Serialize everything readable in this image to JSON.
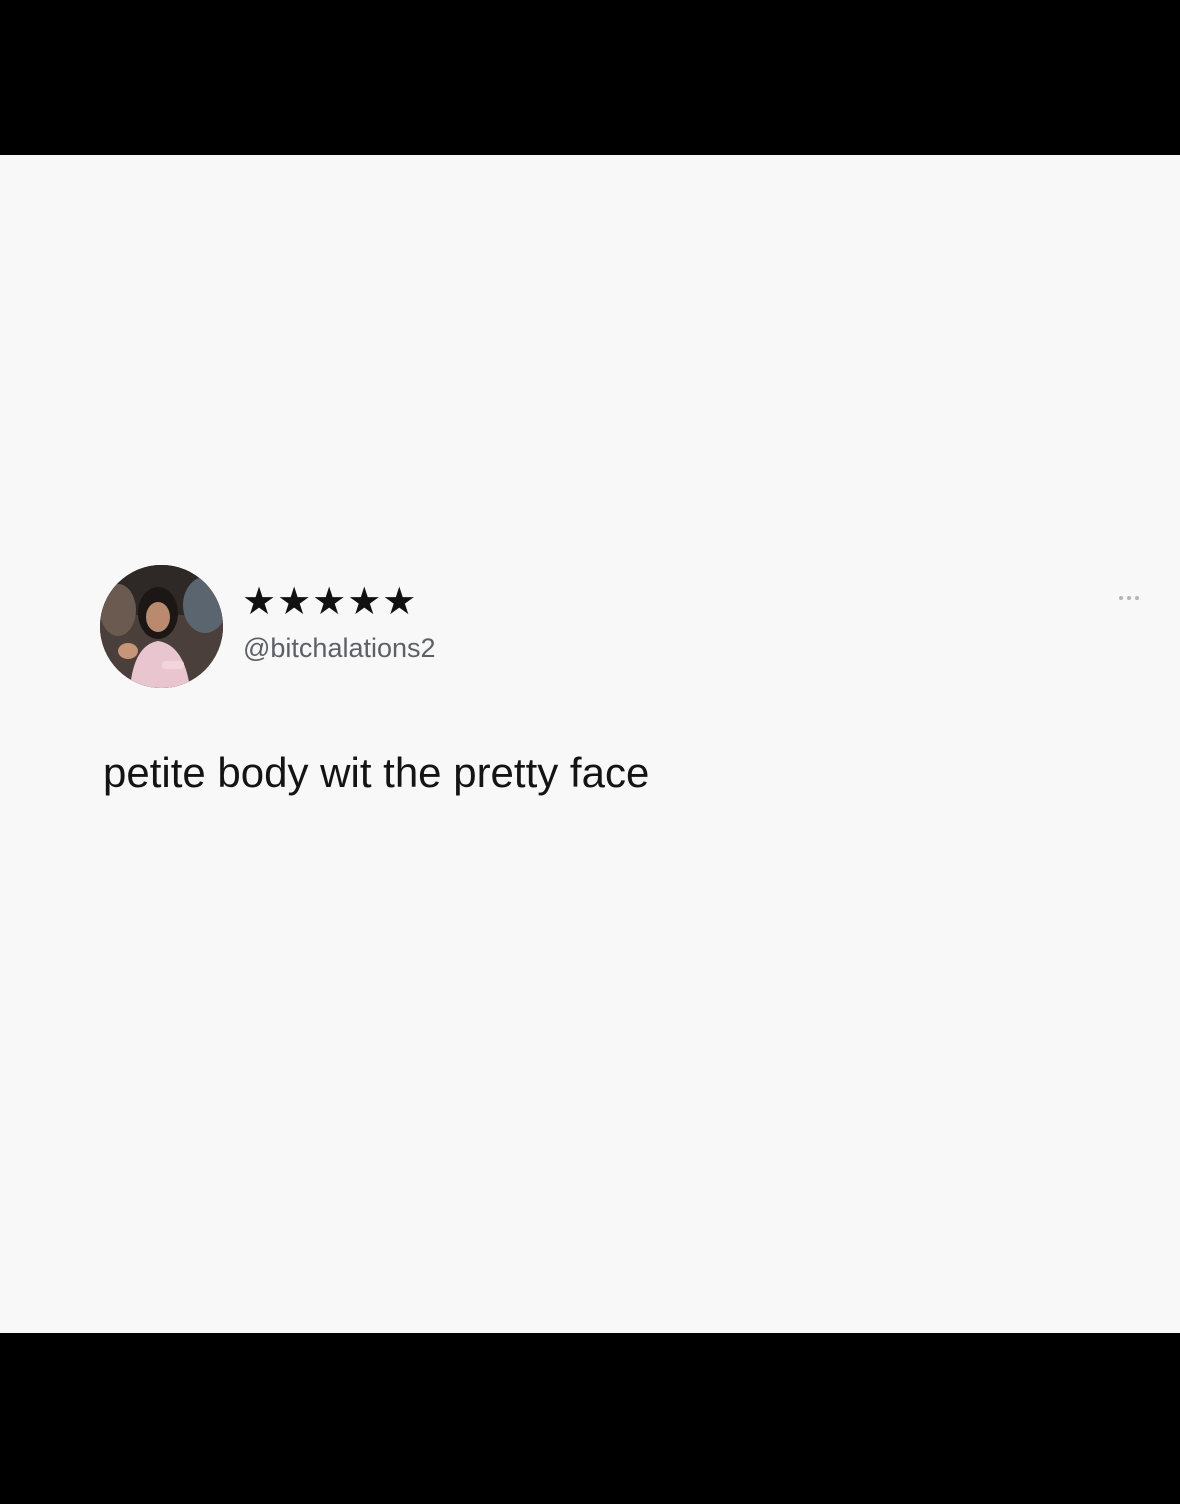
{
  "tweet": {
    "display_name": "★★★★★",
    "handle": "@bitchalations2",
    "text": "petite body wit the pretty face",
    "more_icon": "more-horizontal-icon",
    "avatar": "profile-photo"
  },
  "colors": {
    "letterbox": "#000000",
    "card_background": "#f8f8f9",
    "text_primary": "#141414",
    "text_secondary": "#5c6168",
    "icon_muted": "#b3b6ba"
  }
}
